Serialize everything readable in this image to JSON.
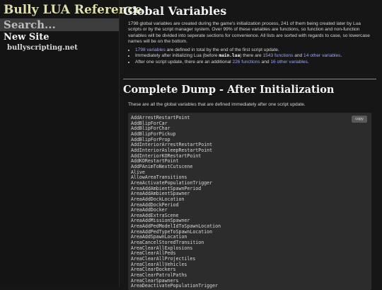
{
  "sidebar": {
    "site_title": "Bully LUA Reference",
    "search_placeholder": "Search...",
    "nav_heading": "New Site",
    "nav_link": "bullyscripting.net"
  },
  "main": {
    "title": "Global Variables",
    "intro": "1798 global variables are created during the game's initialization process, 241 of them being created later by Lua scripts or by the script manager system. Over 99% of these variables are functions, so function and non-function variables will be divided into seperate sections for convenience. All lists are sorted with regards to case, so lowercase names will be on the bottom.",
    "stats": [
      {
        "link": "1798 variables",
        "text": " are defined in total by the end of the first script update."
      },
      {
        "pre": "Immediately after initializing Lua (before ",
        "code": "main.lua",
        "mid": ") there are ",
        "link1": "1543 functions",
        "and": " and ",
        "link2": "14 other variables",
        "end": "."
      },
      {
        "pre": "After one script update, there are an additional ",
        "link1": "226 functions",
        "and": " and ",
        "link2": "16 other variables",
        "end": "."
      }
    ],
    "section_title": "Complete Dump - After Initialization",
    "section_desc": "These are all the global variables that are defined immediately after one script update.",
    "copy_label": "copy",
    "dump_lines": [
      "AddArrestRestartPoint",
      "AddBlipForCar",
      "AddBlipForChar",
      "AddBlipForPickup",
      "AddBlipForProp",
      "AddInteriorArrestRestartPoint",
      "AddInteriorAsleepRestartPoint",
      "AddInteriorKORestartPoint",
      "AddKORestartPoint",
      "AddPAnimToNextCutscene",
      "Alive",
      "AllowAreaTransitions",
      "AreaActivatePopulationTrigger",
      "AreaAddAmbientSpawnPeriod",
      "AreaAddAmbientSpawner",
      "AreaAddDockLocation",
      "AreaAddDockPeriod",
      "AreaAddDocker",
      "AreaAddExtraScene",
      "AreaAddMissionSpawner",
      "AreaAddPedModelIdToSpawnLocation",
      "AreaAddPedTypeToSpawnLocation",
      "AreaAddSpawnLocation",
      "AreaCancelStoredTransition",
      "AreaClearAllExplosions",
      "AreaClearAllPeds",
      "AreaClearAllProjectiles",
      "AreaClearAllVehicles",
      "AreaClearDockers",
      "AreaClearPatrolPaths",
      "AreaClearSpawners",
      "AreaDeactivatePopulationTrigger"
    ]
  }
}
